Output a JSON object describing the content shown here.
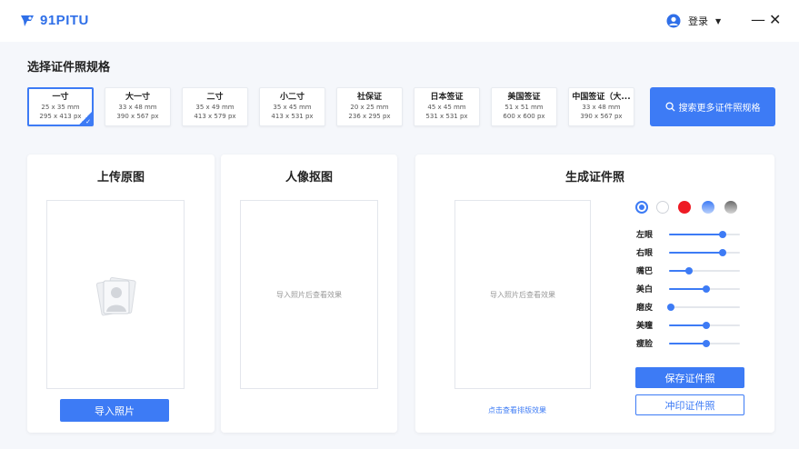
{
  "app": {
    "name": "91PITU",
    "brand_color": "#2f6fe8"
  },
  "header": {
    "login_label": "登录",
    "login_caret": "▼",
    "minimize": "—",
    "close": "✕"
  },
  "spec_section": {
    "title": "选择证件照规格",
    "items": [
      {
        "name": "一寸",
        "mm": "25 x 35 mm",
        "px": "295 x 413 px",
        "selected": true
      },
      {
        "name": "大一寸",
        "mm": "33 x 48 mm",
        "px": "390 x 567 px",
        "selected": false
      },
      {
        "name": "二寸",
        "mm": "35 x 49 mm",
        "px": "413 x 579 px",
        "selected": false
      },
      {
        "name": "小二寸",
        "mm": "35 x 45 mm",
        "px": "413 x 531 px",
        "selected": false
      },
      {
        "name": "社保证",
        "mm": "20 x 25 mm",
        "px": "236 x 295 px",
        "selected": false
      },
      {
        "name": "日本签证",
        "mm": "45 x 45 mm",
        "px": "531 x 531 px",
        "selected": false
      },
      {
        "name": "美国签证",
        "mm": "51 x 51 mm",
        "px": "600 x 600 px",
        "selected": false
      },
      {
        "name": "中国签证（大...",
        "mm": "33 x 48 mm",
        "px": "390 x 567 px",
        "selected": false
      }
    ],
    "search_button": "搜索更多证件照规格"
  },
  "upload_panel": {
    "title": "上传原图",
    "button": "导入照片"
  },
  "cutout_panel": {
    "title": "人像抠图",
    "placeholder": "导入照片后查看效果"
  },
  "generate_panel": {
    "title": "生成证件照",
    "placeholder": "导入照片后查看效果",
    "layout_link": "点击查看排版效果",
    "background_colors": [
      {
        "name": "blue",
        "color": "#3d7bf5",
        "selected": true
      },
      {
        "name": "white",
        "color": "#ffffff",
        "selected": false
      },
      {
        "name": "red",
        "color": "#ee1b24",
        "selected": false
      },
      {
        "name": "blue-gradient",
        "color": "#7aa7f0",
        "selected": false
      },
      {
        "name": "gray-gradient",
        "color": "#9a9a9a",
        "selected": false
      }
    ],
    "sliders": [
      {
        "label": "左眼",
        "value": 0.75
      },
      {
        "label": "右眼",
        "value": 0.75
      },
      {
        "label": "嘴巴",
        "value": 0.28
      },
      {
        "label": "美白",
        "value": 0.52
      },
      {
        "label": "磨皮",
        "value": 0.02
      },
      {
        "label": "美瞳",
        "value": 0.52
      },
      {
        "label": "瘦脸",
        "value": 0.52
      }
    ],
    "save_button": "保存证件照",
    "print_button": "冲印证件照"
  }
}
